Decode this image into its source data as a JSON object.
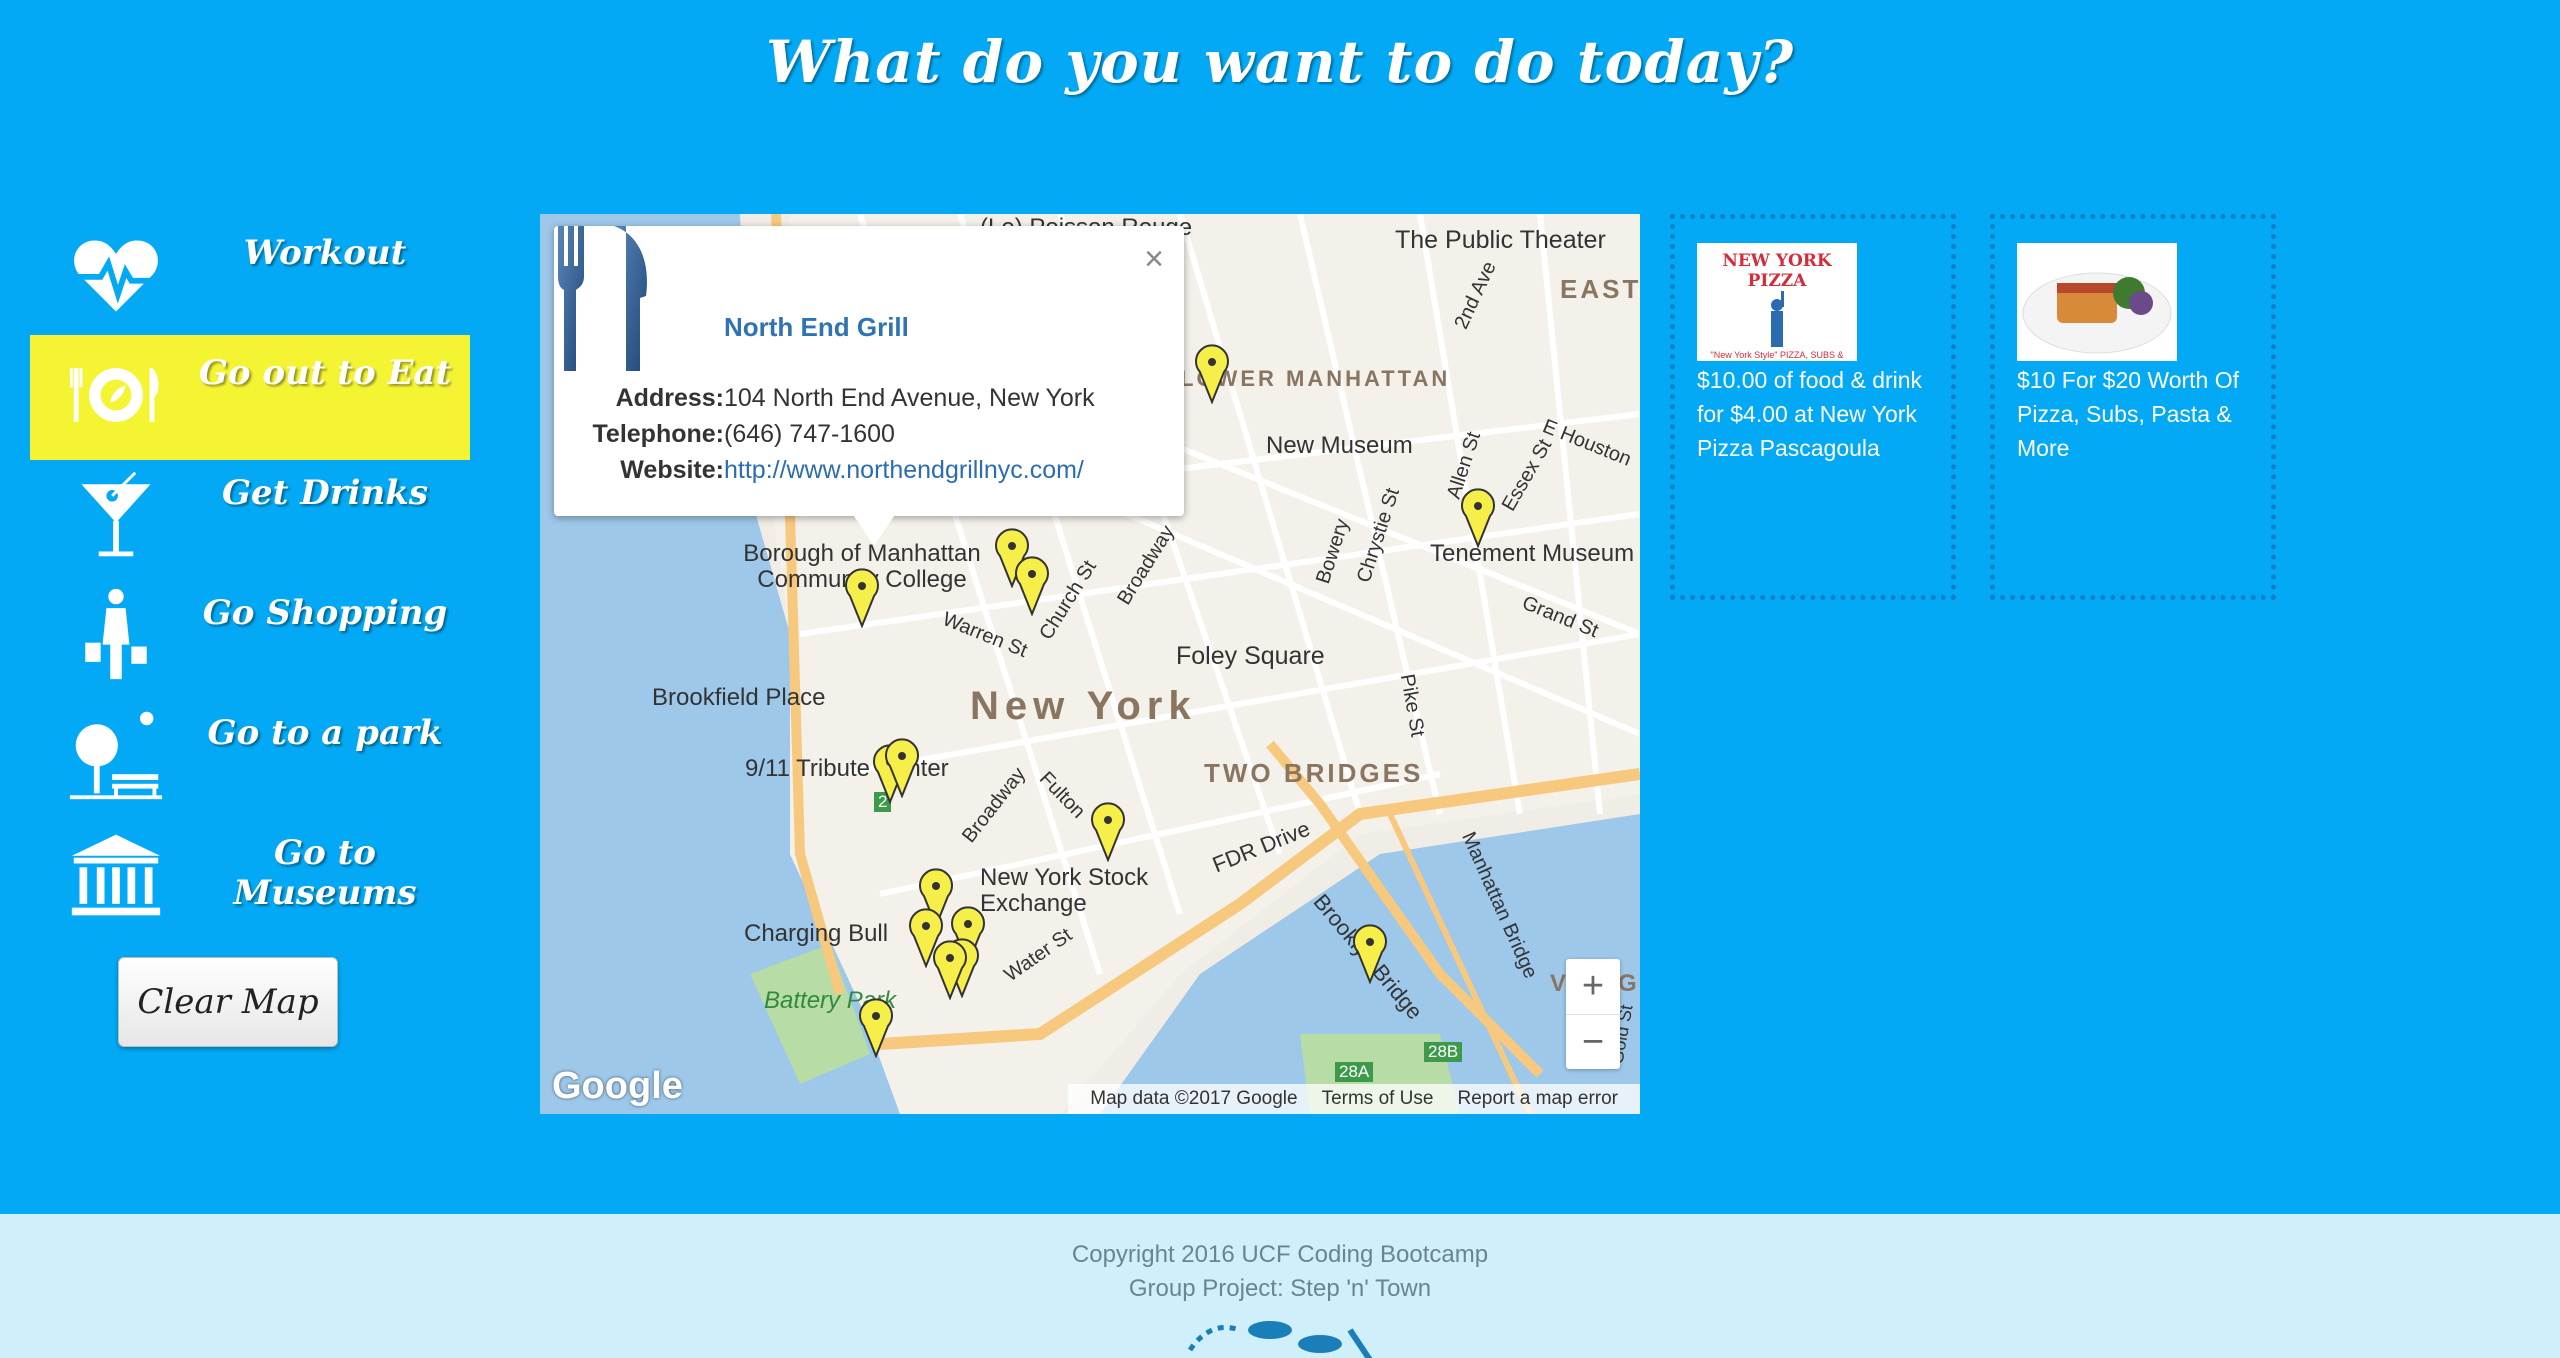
{
  "page": {
    "title": "What do you want to do today?"
  },
  "sidebar": {
    "items": [
      {
        "label": "Workout",
        "icon": "heartbeat-icon",
        "active": false
      },
      {
        "label": "Go out to Eat",
        "icon": "plate-fork-knife-icon",
        "active": true
      },
      {
        "label": "Get Drinks",
        "icon": "cocktail-icon",
        "active": false
      },
      {
        "label": "Go Shopping",
        "icon": "shopper-icon",
        "active": false
      },
      {
        "label": "Go to a park",
        "icon": "park-bench-tree-icon",
        "active": false
      },
      {
        "label": "Go to Museums",
        "icon": "museum-icon",
        "active": false
      }
    ],
    "clear_label": "Clear Map"
  },
  "map": {
    "popup": {
      "name": "North End Grill",
      "address_label": "Address:",
      "address": "104 North End Avenue, New York",
      "telephone_label": "Telephone:",
      "telephone": "(646) 747-1600",
      "website_label": "Website:",
      "website": "http://www.northendgrillnyc.com/",
      "close": "×"
    },
    "labels": {
      "poisson": "(Le) Poisson Rouge",
      "public_theater": "The Public Theater",
      "east": "EAST",
      "lower_manhattan": "LOWER MANHATTAN",
      "new_museum": "New Museum",
      "tenement": "Tenement Museum",
      "bmcc": "Borough of Manhattan Community College",
      "foley": "Foley Square",
      "brookfield": "Brookfield Place",
      "new_york": "New York",
      "two_bridges": "TWO BRIDGES",
      "tribute": "9/11 Tribute Center",
      "nyse": "New York Stock Exchange",
      "charging_bull": "Charging Bull",
      "battery_park": "Battery Park",
      "fdr": "FDR Drive",
      "brooklyn_bridge": "Brooklyn Bridge",
      "manhattan_bridge": "Manhattan Bridge",
      "warren": "Warren St",
      "church": "Church St",
      "broadway": "Broadway",
      "broadway2": "Broadway",
      "fulton": "Fulton",
      "water": "Water St",
      "bowery": "Bowery",
      "chrystie": "Chrystie St",
      "allen": "Allen St",
      "essex": "Essex St",
      "houston": "E Houston",
      "grand": "Grand St",
      "pike": "Pike St",
      "second_ave": "2nd Ave",
      "gold": "Gold St",
      "vinegar": "VINEGAR",
      "route28a": "28A",
      "route28b": "28B",
      "route2": "2"
    },
    "attribution": "Map data ©2017 Google",
    "terms": "Terms of Use",
    "report": "Report a map error",
    "logo": "Google",
    "zoom_in": "+",
    "zoom_out": "−"
  },
  "deals": [
    {
      "text": "$10.00 of food & drink for $4.00 at New York Pizza Pascagoula",
      "image_caption": "NEW YORK PIZZA",
      "image_sub": "\"New York Style\" PIZZA, SUBS & WINGS"
    },
    {
      "text": "$10 For $20 Worth Of Pizza, Subs, Pasta & More"
    }
  ],
  "footer": {
    "copyright": "Copyright 2016 UCF Coding Bootcamp",
    "project": "Group Project: Step 'n' Town"
  },
  "colors": {
    "background": "#03a9f4",
    "active": "#f4f433",
    "footer": "#cfeffb",
    "pin": "#f6ef4a"
  }
}
